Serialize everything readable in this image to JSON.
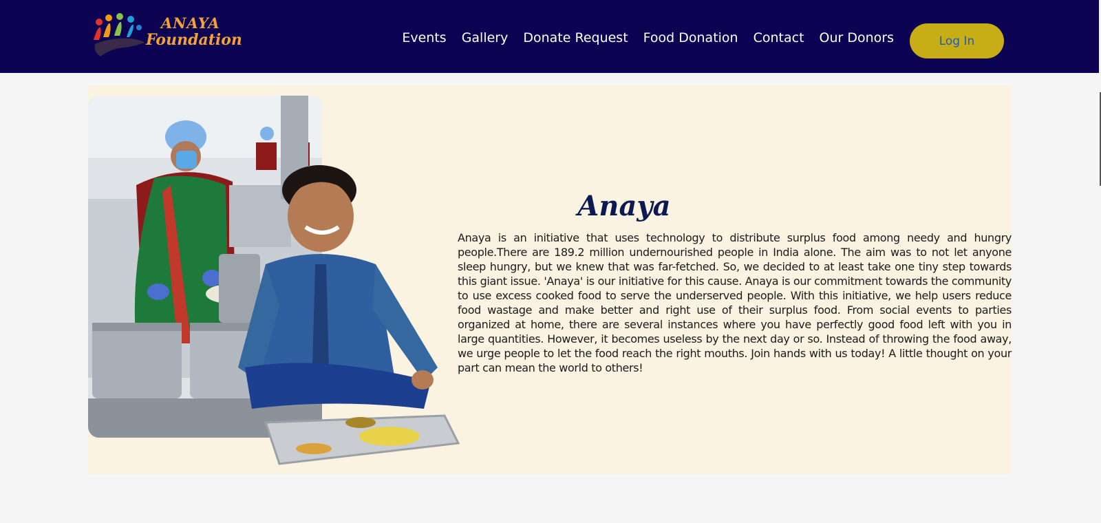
{
  "brand": {
    "word1": "ANAYA",
    "word2": "Foundation",
    "colors": {
      "accent": "#f2a23a",
      "navbar": "#0c0352",
      "button": "#c7ae16"
    }
  },
  "nav": {
    "items": [
      "Events",
      "Gallery",
      "Donate Request",
      "Food Donation",
      "Contact",
      "Our Donors"
    ],
    "login_label": "Log In"
  },
  "about": {
    "title": "Anaya",
    "body": "Anaya is an initiative that uses technology to distribute surplus food among needy and hungry people.There are 189.2 million undernourished people in India alone. The aim was to not let anyone sleep hungry, but we knew that was far-fetched. So, we decided to at least take one tiny step towards this giant issue. 'Anaya' is our initiative for this cause. Anaya is our commitment towards the community to use excess cooked food to serve the underserved people. With this initiative, we help users reduce food wastage and make better and right use of their surplus food. From social events to parties organized at home, there are several instances where you have perfectly good food left with you in large quantities. However, it becomes useless by the next day or so. Instead of throwing the food away, we urge people to let the food reach the right mouths. Join hands with us today! A little thought on your part can mean the world to others!"
  }
}
